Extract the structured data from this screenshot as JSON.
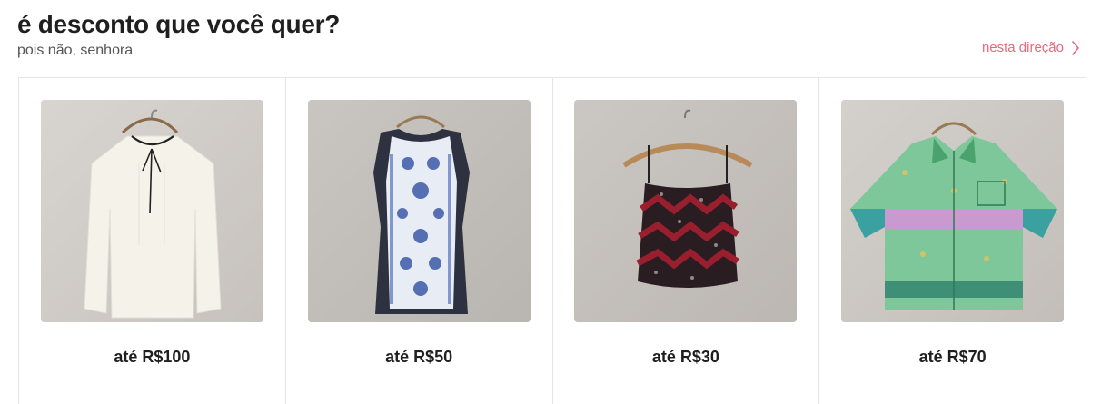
{
  "header": {
    "title": "é desconto que você quer?",
    "subtitle": "pois não, senhora",
    "see_more": "nesta direção"
  },
  "colors": {
    "accent": "#e8697d",
    "text": "#1f1f1f",
    "muted": "#555555",
    "border": "#e6e6e6"
  },
  "cards": [
    {
      "label": "até R$100",
      "item": "white-blouse-image"
    },
    {
      "label": "até R$50",
      "item": "blue-print-dress-image"
    },
    {
      "label": "até R$30",
      "item": "sequin-cami-image"
    },
    {
      "label": "até R$70",
      "item": "green-print-shirt-image"
    }
  ]
}
